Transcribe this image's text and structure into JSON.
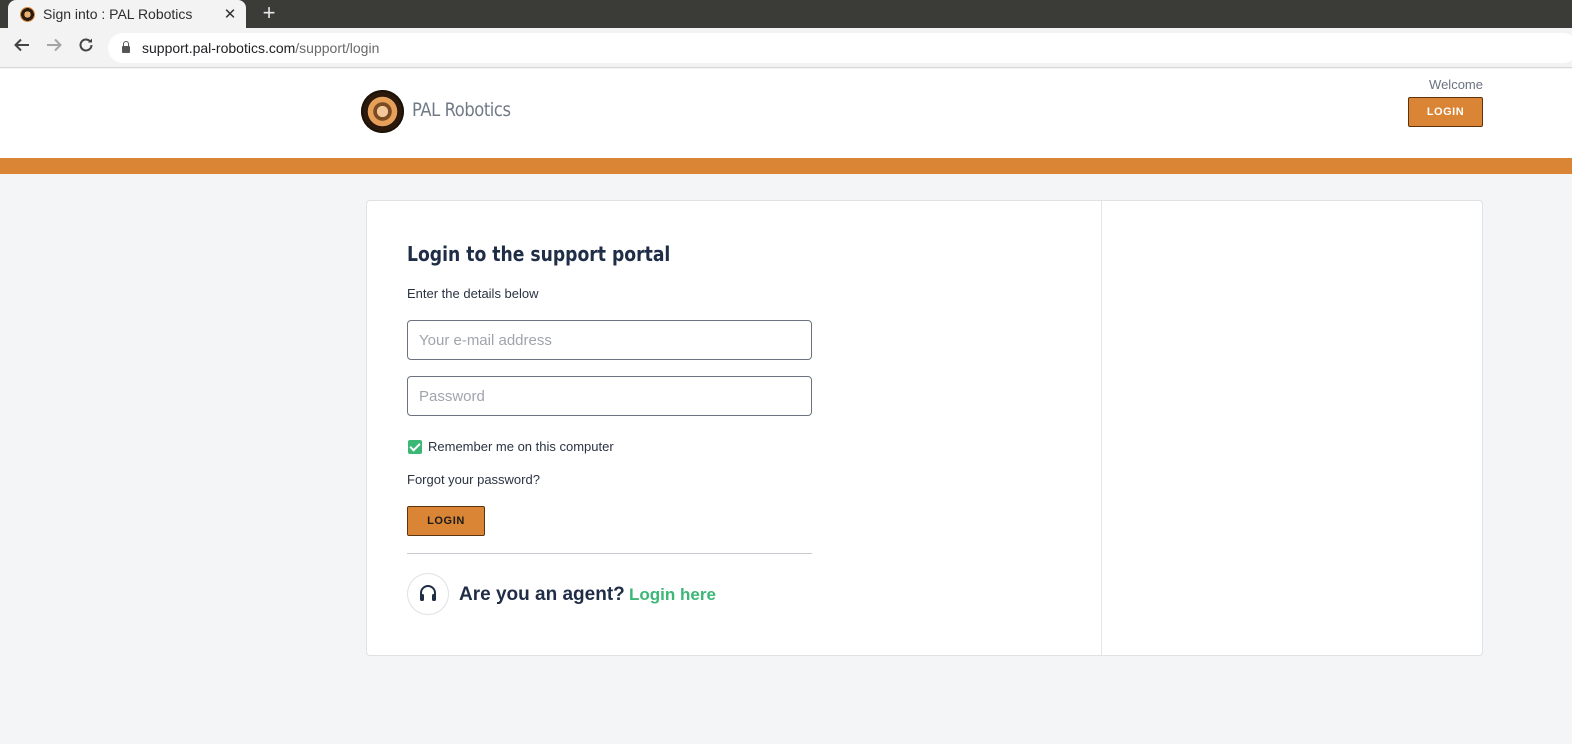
{
  "browser": {
    "tab_title": "Sign into : PAL Robotics",
    "close_glyph": "✕",
    "new_tab_glyph": "+",
    "url_host": "support.pal-robotics.com",
    "url_path": "/support/login"
  },
  "header": {
    "brand_name": "PAL Robotics",
    "welcome_text": "Welcome",
    "login_label": "LOGIN",
    "band_color": "#d98535"
  },
  "login_form": {
    "heading": "Login to the support portal",
    "subtext": "Enter the details below",
    "email_placeholder": "Your e-mail address",
    "password_placeholder": "Password",
    "remember_label": "Remember me on this computer",
    "remember_checked": true,
    "forgot_label": "Forgot your password?",
    "submit_label": "LOGIN"
  },
  "agent": {
    "question": "Are you an agent?",
    "link_label": "Login here",
    "link_color": "#3bb776"
  }
}
